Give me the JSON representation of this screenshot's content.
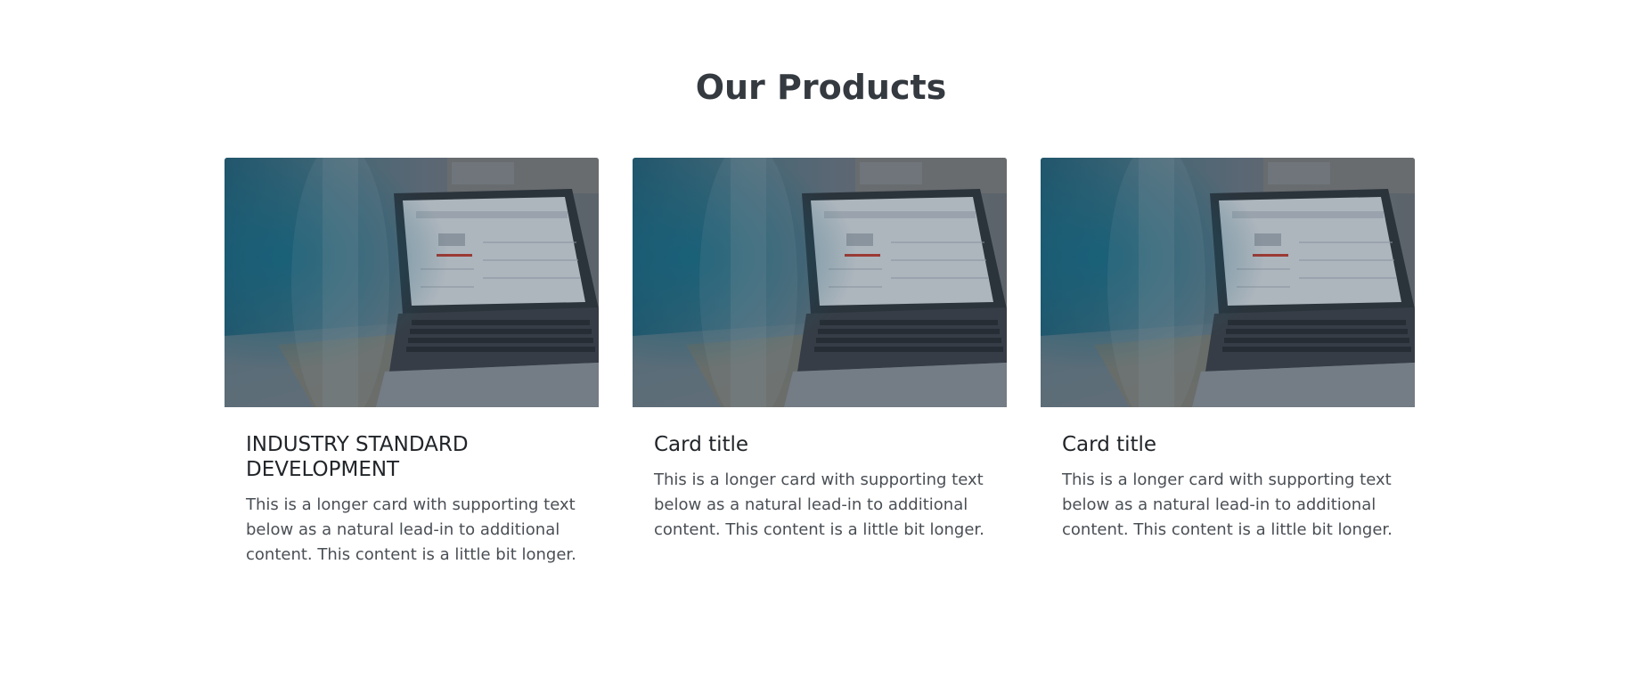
{
  "section": {
    "title": "Our Products"
  },
  "cards": [
    {
      "image_icon": "laptop-photo",
      "title": "INDUSTRY STANDARD DEVELOPMENT",
      "text": "This is a longer card with supporting text below as a natural lead-in to additional content. This content is a little bit longer."
    },
    {
      "image_icon": "laptop-photo",
      "title": "Card title",
      "text": "This is a longer card with supporting text below as a natural lead-in to additional content. This content is a little bit longer."
    },
    {
      "image_icon": "laptop-photo",
      "title": "Card title",
      "text": "This is a longer card with supporting text below as a natural lead-in to additional content. This content is a little bit longer."
    }
  ],
  "colors": {
    "heading": "#343a40",
    "body_text": "#4a4f55",
    "image_overlay": "#2c3e50"
  }
}
